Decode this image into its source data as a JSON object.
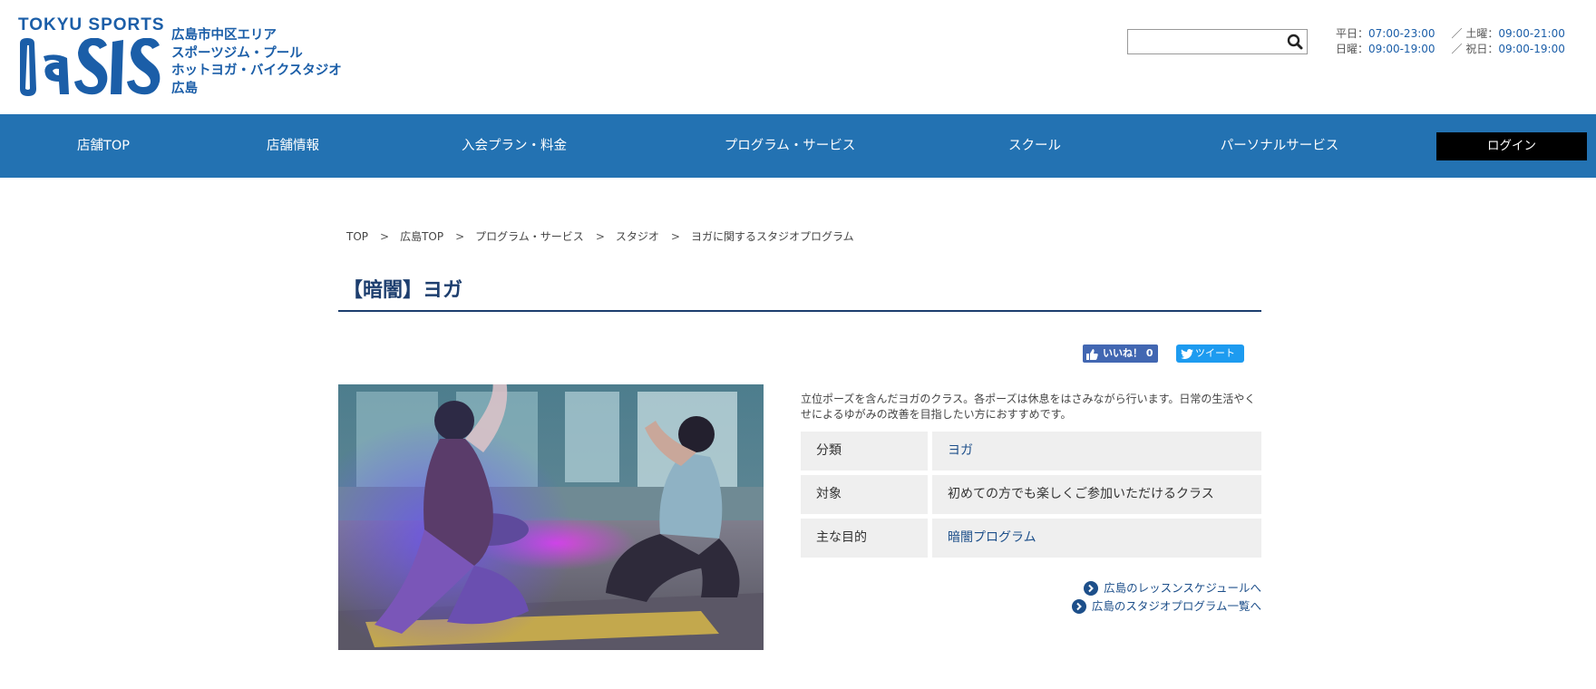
{
  "header": {
    "brand_top": "TOKYU SPORTS",
    "brand_logo": "OASIS",
    "store_lines": [
      "広島市中区エリア",
      "スポーツジム・プール",
      "ホットヨガ・バイクスタジオ",
      "広島"
    ],
    "search": {
      "value": "",
      "placeholder": ""
    },
    "hours": {
      "row1": {
        "label1": "平日：",
        "value1": "07:00-23:00",
        "label2": "／ 土曜：",
        "value2": "09:00-21:00"
      },
      "row2": {
        "label1": "日曜：",
        "value1": "09:00-19:00",
        "label2": "／ 祝日：",
        "value2": "09:00-19:00"
      }
    }
  },
  "nav": {
    "items": [
      "店舗TOP",
      "店舗情報",
      "入会プラン・料金",
      "プログラム・サービス",
      "スクール",
      "パーソナルサービス"
    ],
    "login_label": "ログイン"
  },
  "breadcrumb": [
    "TOP",
    "広島TOP",
    "プログラム・サービス",
    "スタジオ",
    "ヨガに関するスタジオプログラム"
  ],
  "breadcrumb_separator": ">",
  "page_title": "【暗闇】ヨガ",
  "social": {
    "like_label": "いいね！ 0",
    "tweet_label": "ツイート"
  },
  "description": "立位ポーズを含んだヨガのクラス。各ポーズは休息をはさみながら行います。日常の生活やくせによるゆがみの改善を目指したい方におすすめです。",
  "info": [
    {
      "label": "分類",
      "value": "ヨガ"
    },
    {
      "label": "対象",
      "value": "初めての方でも楽しくご参加いただけるクラス"
    },
    {
      "label": "主な目的",
      "value": "暗闇プログラム"
    }
  ],
  "links": {
    "schedule": "広島のレッスンスケジュールへ",
    "program_list": "広島のスタジオプログラム一覧へ"
  },
  "colors": {
    "brand_blue": "#1b5ea8",
    "nav_blue": "#2372b2",
    "title_navy": "#1d3e6e",
    "login_black": "#000000",
    "facebook": "#4267b2",
    "twitter": "#1d9bf0"
  },
  "icons": [
    "search-icon",
    "thumbs-up-icon",
    "twitter-bird-icon",
    "circle-arrow-right-icon"
  ]
}
